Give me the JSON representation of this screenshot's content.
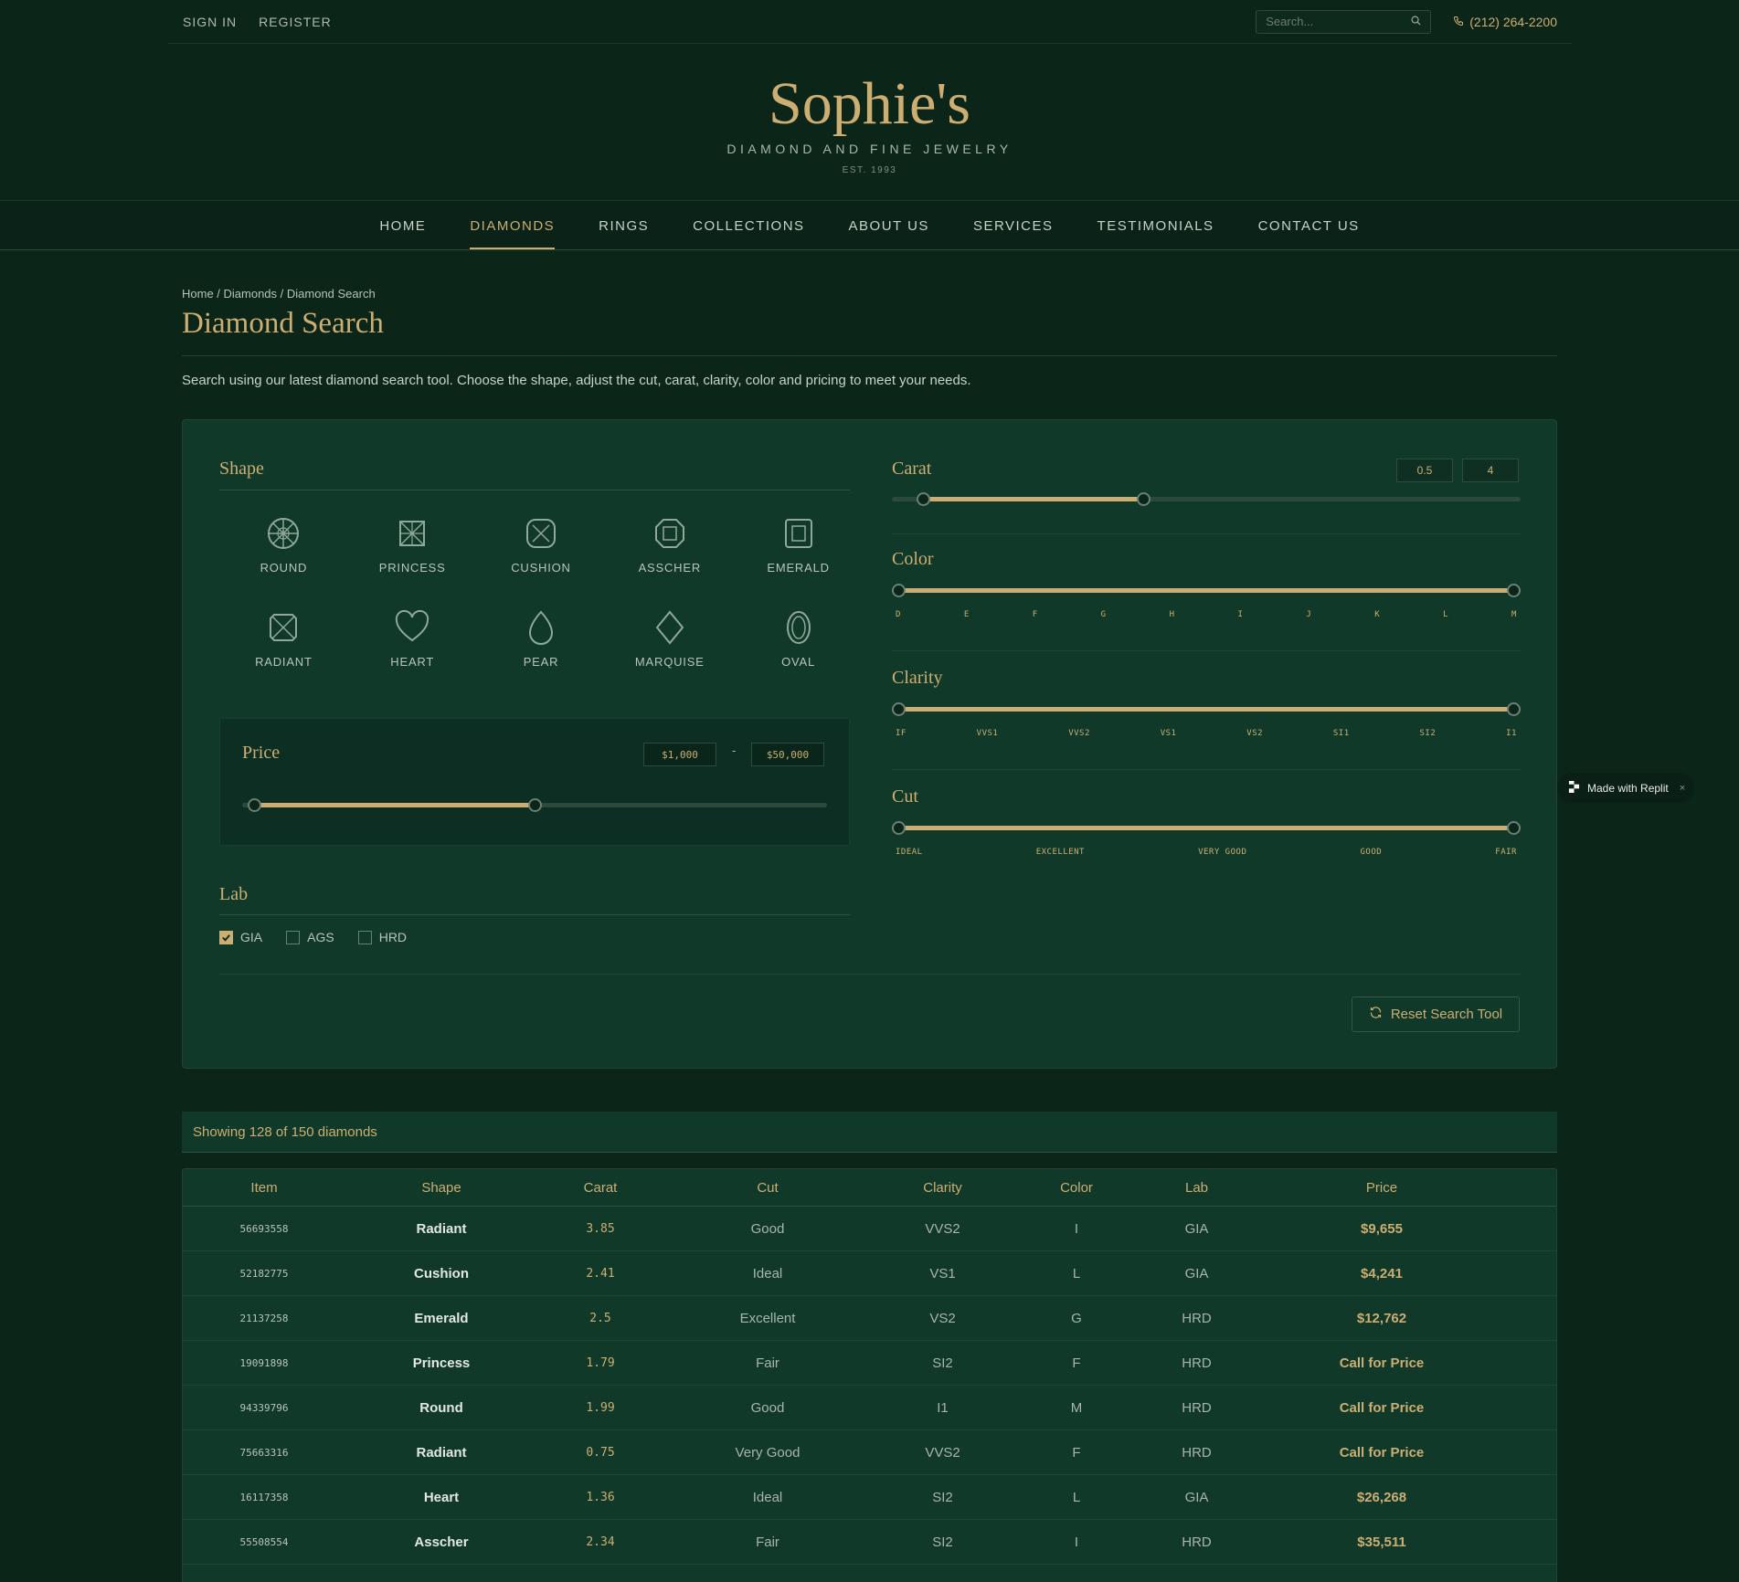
{
  "topbar": {
    "sign_in": "SIGN IN",
    "register": "REGISTER",
    "search_placeholder": "Search...",
    "phone": "(212) 264-2200"
  },
  "brand": {
    "name": "Sophie's",
    "tagline": "DIAMOND AND FINE JEWELRY",
    "est": "EST. 1993"
  },
  "nav": [
    {
      "label": "HOME",
      "active": false
    },
    {
      "label": "DIAMONDS",
      "active": true
    },
    {
      "label": "RINGS",
      "active": false
    },
    {
      "label": "COLLECTIONS",
      "active": false
    },
    {
      "label": "ABOUT US",
      "active": false
    },
    {
      "label": "SERVICES",
      "active": false
    },
    {
      "label": "TESTIMONIALS",
      "active": false
    },
    {
      "label": "CONTACT US",
      "active": false
    }
  ],
  "page": {
    "breadcrumb": "Home / Diamonds / Diamond Search",
    "title": "Diamond Search",
    "intro": "Search using our latest diamond search tool. Choose the shape, adjust the cut, carat, clarity, color and pricing to meet your needs."
  },
  "filters": {
    "shape_title": "Shape",
    "shapes": [
      {
        "label": "ROUND",
        "icon": "round-icon"
      },
      {
        "label": "PRINCESS",
        "icon": "princess-icon"
      },
      {
        "label": "CUSHION",
        "icon": "cushion-icon"
      },
      {
        "label": "ASSCHER",
        "icon": "asscher-icon"
      },
      {
        "label": "EMERALD",
        "icon": "emerald-icon"
      },
      {
        "label": "RADIANT",
        "icon": "radiant-icon"
      },
      {
        "label": "HEART",
        "icon": "heart-icon"
      },
      {
        "label": "PEAR",
        "icon": "pear-icon"
      },
      {
        "label": "MARQUISE",
        "icon": "marquise-icon"
      },
      {
        "label": "OVAL",
        "icon": "oval-icon"
      }
    ],
    "price": {
      "title": "Price",
      "min": "$1,000",
      "sep": "-",
      "max": "$50,000",
      "range_fraction": [
        0.02,
        0.5
      ]
    },
    "lab": {
      "title": "Lab",
      "options": [
        {
          "label": "GIA",
          "checked": true
        },
        {
          "label": "AGS",
          "checked": false
        },
        {
          "label": "HRD",
          "checked": false
        }
      ]
    },
    "carat": {
      "title": "Carat",
      "min": "0.5",
      "max": "4",
      "range_fraction": [
        0.05,
        0.4
      ]
    },
    "color": {
      "title": "Color",
      "scale": [
        "D",
        "E",
        "F",
        "G",
        "H",
        "I",
        "J",
        "K",
        "L",
        "M"
      ],
      "range_fraction": [
        0,
        1
      ]
    },
    "clarity": {
      "title": "Clarity",
      "scale": [
        "IF",
        "VVS1",
        "VVS2",
        "VS1",
        "VS2",
        "SI1",
        "SI2",
        "I1"
      ],
      "range_fraction": [
        0,
        1
      ]
    },
    "cut": {
      "title": "Cut",
      "scale": [
        "IDEAL",
        "EXCELLENT",
        "VERY GOOD",
        "GOOD",
        "FAIR"
      ],
      "range_fraction": [
        0,
        1
      ]
    },
    "reset_label": "Reset Search Tool"
  },
  "results": {
    "summary": "Showing 128 of 150 diamonds",
    "columns": [
      "Item",
      "Shape",
      "Carat",
      "Cut",
      "Clarity",
      "Color",
      "Lab",
      "Price"
    ],
    "rows": [
      [
        "56693558",
        "Radiant",
        "3.85",
        "Good",
        "VVS2",
        "I",
        "GIA",
        "$9,655"
      ],
      [
        "52182775",
        "Cushion",
        "2.41",
        "Ideal",
        "VS1",
        "L",
        "GIA",
        "$4,241"
      ],
      [
        "21137258",
        "Emerald",
        "2.5",
        "Excellent",
        "VS2",
        "G",
        "HRD",
        "$12,762"
      ],
      [
        "19091898",
        "Princess",
        "1.79",
        "Fair",
        "SI2",
        "F",
        "HRD",
        "Call for Price"
      ],
      [
        "94339796",
        "Round",
        "1.99",
        "Good",
        "I1",
        "M",
        "HRD",
        "Call for Price"
      ],
      [
        "75663316",
        "Radiant",
        "0.75",
        "Very Good",
        "VVS2",
        "F",
        "HRD",
        "Call for Price"
      ],
      [
        "16117358",
        "Heart",
        "1.36",
        "Ideal",
        "SI2",
        "L",
        "GIA",
        "$26,268"
      ],
      [
        "55508554",
        "Asscher",
        "2.34",
        "Fair",
        "SI2",
        "I",
        "HRD",
        "$35,511"
      ]
    ]
  },
  "badge": {
    "label": "Made with Replit",
    "close": "×"
  },
  "colors": {
    "background": "#0b2519",
    "panel": "#10392a",
    "accent": "#cdae72"
  }
}
